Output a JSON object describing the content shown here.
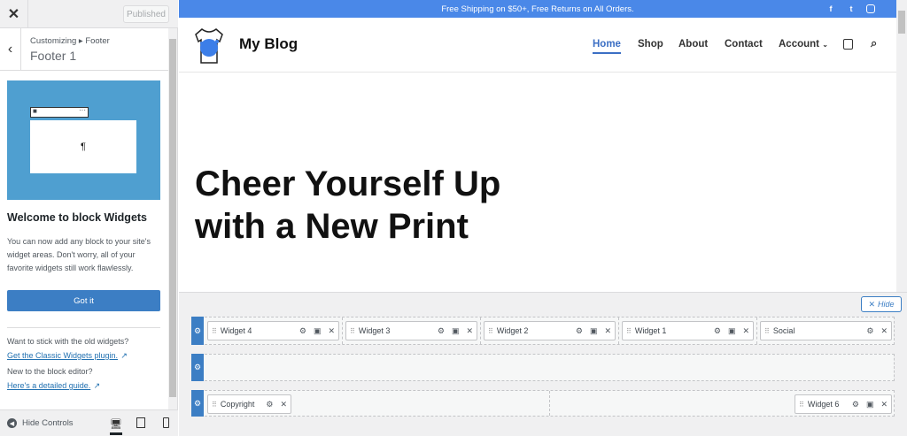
{
  "sidebar": {
    "close_label": "✕",
    "published": "Published",
    "breadcrumb": "Customizing ▸ Footer",
    "title": "Footer 1",
    "illustration_glyph": "¶",
    "welcome_title": "Welcome to block Widgets",
    "welcome_text": "You can now add any block to your site's widget areas. Don't worry, all of your favorite widgets still work flawlessly.",
    "got_it": "Got it",
    "classic_q": "Want to stick with the old widgets?",
    "classic_link": "Get the Classic Widgets plugin.",
    "editor_q": "New to the block editor?",
    "editor_link": "Here's a detailed guide.",
    "hide_controls": "Hide Controls"
  },
  "preview": {
    "promo": "Free Shipping on $50+, Free Returns on All Orders.",
    "site_title": "My Blog",
    "nav": [
      "Home",
      "Shop",
      "About",
      "Contact",
      "Account"
    ],
    "hero": "Cheer Yourself Up with a New Print"
  },
  "builder": {
    "hide": "Hide",
    "row1": [
      "Widget 4",
      "Widget 3",
      "Widget 2",
      "Widget 1",
      "Social"
    ],
    "row3_left": "Copyright",
    "row3_right": "Widget 6"
  },
  "colors": {
    "accent": "#3c7ec4",
    "promo": "#4a88e8",
    "illustration": "#4f9fd0"
  }
}
